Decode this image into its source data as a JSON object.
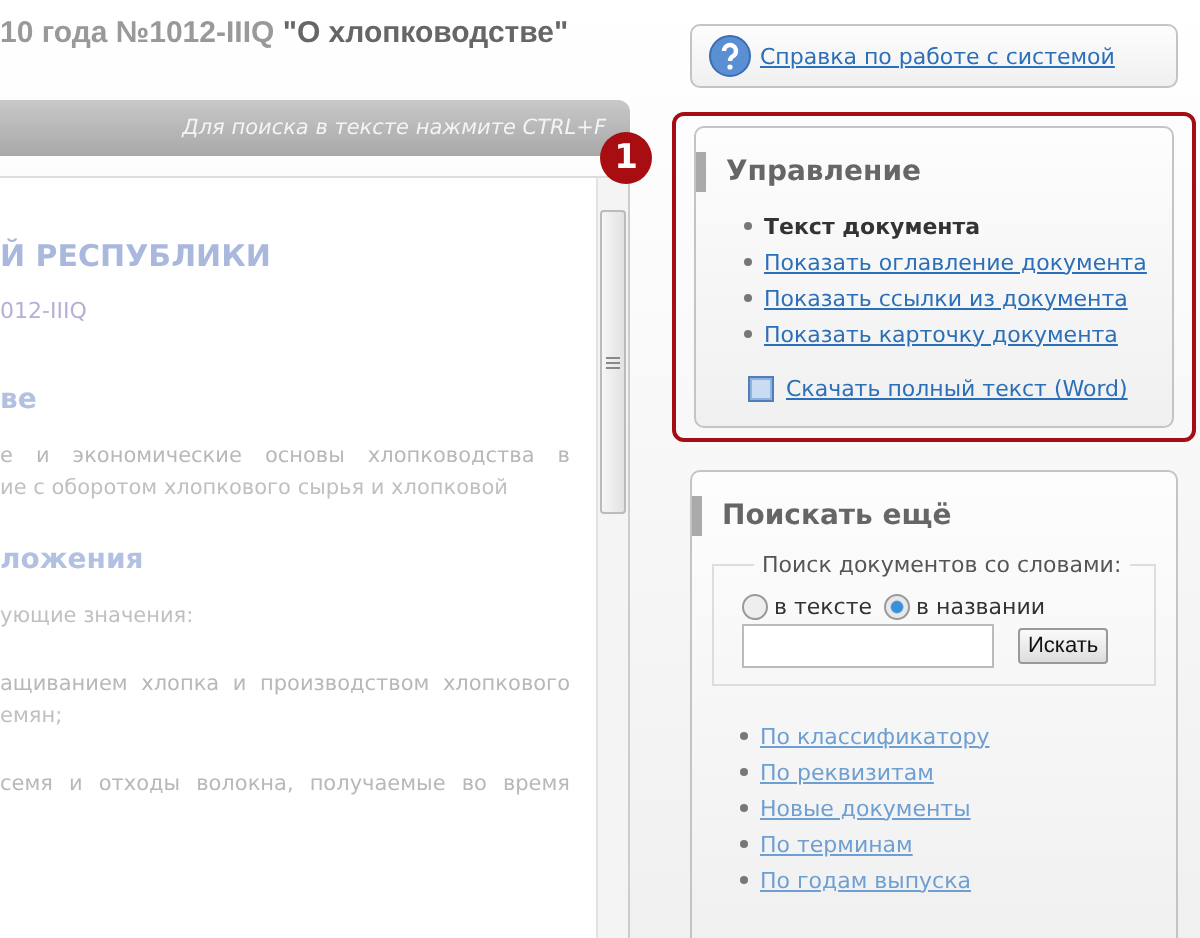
{
  "document": {
    "title_muted": "10 года №1012-IIIQ ",
    "title_bold": "\"О хлопководстве\"",
    "search_hint": "Для поиска в тексте нажмите CTRL+F",
    "lines": [
      {
        "kind": "heading",
        "text": "Й РЕСПУБЛИКИ"
      },
      {
        "kind": "number",
        "text": "012-IIIQ"
      },
      {
        "kind": "subheading",
        "text": "ве"
      },
      {
        "kind": "para",
        "text": "е и экономические основы хлопководства в"
      },
      {
        "kind": "para_last",
        "text": "ие с оборотом хлопкового сырья и хлопковой"
      },
      {
        "kind": "subheading",
        "text": "ложения"
      },
      {
        "kind": "para_last",
        "text": "ующие значения:"
      },
      {
        "kind": "para",
        "text": "ащиванием хлопка и производством хлопкового"
      },
      {
        "kind": "para_last",
        "text": "емян;"
      },
      {
        "kind": "para",
        "text": "семя и отходы волокна, получаемые во время"
      }
    ]
  },
  "badge": "1",
  "help": {
    "link": "Справка по работе с системой"
  },
  "management": {
    "title": "Управление",
    "items": [
      {
        "text": "Текст документа",
        "selected": true
      },
      {
        "text": "Показать оглавление документа",
        "selected": false
      },
      {
        "text": "Показать ссылки из документа",
        "selected": false
      },
      {
        "text": "Показать карточку документа",
        "selected": false
      }
    ],
    "download": "Скачать полный текст (Word)"
  },
  "search": {
    "title": "Поискать ещё",
    "legend": "Поиск документов со словами:",
    "options": [
      {
        "label": "в тексте",
        "selected": false
      },
      {
        "label": "в названии",
        "selected": true
      }
    ],
    "button": "Искать",
    "links": [
      "По классификатору",
      "По реквизитам",
      "Новые документы",
      "По терминам",
      "По годам выпуска"
    ]
  }
}
